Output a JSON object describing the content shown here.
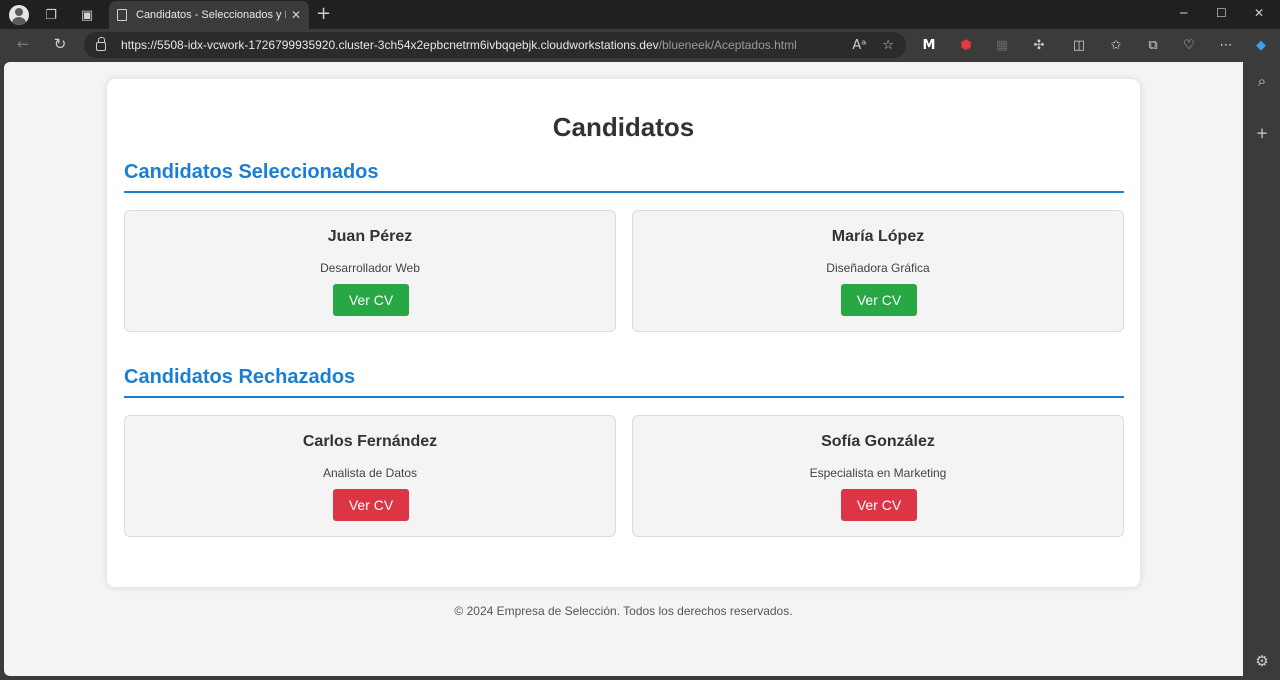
{
  "browser": {
    "tab_title": "Candidatos - Seleccionados y Rechazados",
    "tab_close": "✕",
    "new_tab": "+",
    "url_host": "https://5508-idx-vcwork-1726799935920.cluster-3ch54x2epbcnetrm6ivbqqebjk.cloudworkstations.dev",
    "url_path": "/blueneek/Aceptados.html"
  },
  "page": {
    "title": "Candidatos",
    "sections": [
      {
        "title": "Candidatos Seleccionados",
        "status": "selected",
        "candidates": [
          {
            "name": "Juan Pérez",
            "role": "Desarrollador Web",
            "button": "Ver CV"
          },
          {
            "name": "María López",
            "role": "Diseñadora Gráfica",
            "button": "Ver CV"
          }
        ]
      },
      {
        "title": "Candidatos Rechazados",
        "status": "rejected",
        "candidates": [
          {
            "name": "Carlos Fernández",
            "role": "Analista de Datos",
            "button": "Ver CV"
          },
          {
            "name": "Sofía González",
            "role": "Especialista en Marketing",
            "button": "Ver CV"
          }
        ]
      }
    ],
    "footer": "© 2024 Empresa de Selección. Todos los derechos reservados."
  },
  "colors": {
    "accent": "#1a7fd4",
    "selected_button": "#28a745",
    "rejected_button": "#dc3545"
  }
}
